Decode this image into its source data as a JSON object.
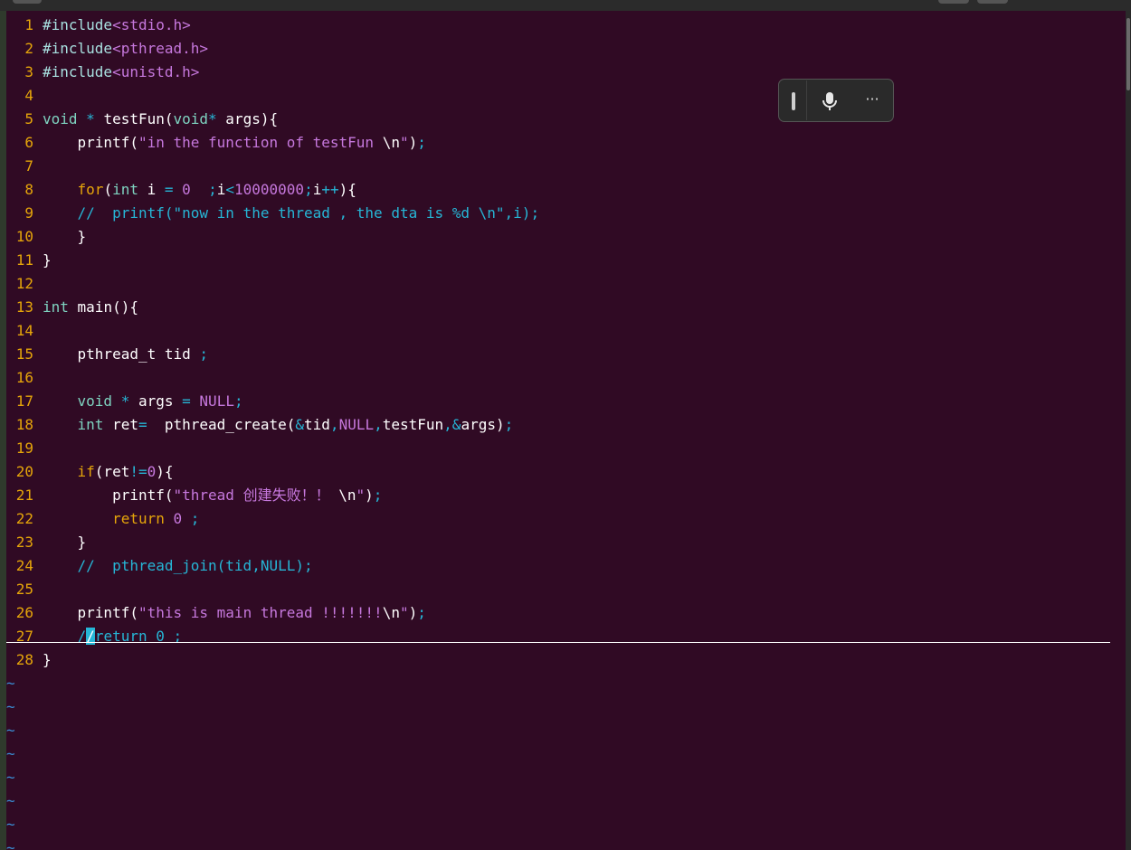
{
  "window": {
    "accent": "#300a24"
  },
  "floatbar": {
    "icons": [
      "drag-handle-icon",
      "microphone-icon",
      "more-options-icon"
    ],
    "more_label": "···"
  },
  "editor": {
    "line_number_color": "#e5a50a",
    "empty_line_marker": "~",
    "cursor_line": 27,
    "lines": [
      {
        "n": "1",
        "tokens": [
          [
            "pp",
            "#include"
          ],
          [
            "str",
            "<stdio.h>"
          ]
        ]
      },
      {
        "n": "2",
        "tokens": [
          [
            "pp",
            "#include"
          ],
          [
            "str",
            "<pthread.h>"
          ]
        ]
      },
      {
        "n": "3",
        "tokens": [
          [
            "pp",
            "#include"
          ],
          [
            "str",
            "<unistd.h>"
          ]
        ]
      },
      {
        "n": "4",
        "tokens": []
      },
      {
        "n": "5",
        "tokens": [
          [
            "kw",
            "void"
          ],
          [
            "op",
            " * "
          ],
          [
            "plain",
            "testFun("
          ],
          [
            "kw",
            "void"
          ],
          [
            "op",
            "*"
          ],
          [
            "plain",
            " args){"
          ]
        ]
      },
      {
        "n": "6",
        "tokens": [
          [
            "plain",
            "    printf("
          ],
          [
            "str",
            "\"in the function of testFun "
          ],
          [
            "plain",
            "\\n"
          ],
          [
            "str",
            "\""
          ],
          [
            "plain",
            ")"
          ],
          [
            "op",
            ";"
          ]
        ]
      },
      {
        "n": "7",
        "tokens": []
      },
      {
        "n": "8",
        "tokens": [
          [
            "plain",
            "    "
          ],
          [
            "ctrl",
            "for"
          ],
          [
            "plain",
            "("
          ],
          [
            "kw",
            "int"
          ],
          [
            "plain",
            " i "
          ],
          [
            "op",
            "="
          ],
          [
            "plain",
            " "
          ],
          [
            "num",
            "0"
          ],
          [
            "plain",
            "  "
          ],
          [
            "op",
            ";"
          ],
          [
            "plain",
            "i"
          ],
          [
            "op",
            "<"
          ],
          [
            "num",
            "10000000"
          ],
          [
            "op",
            ";"
          ],
          [
            "plain",
            "i"
          ],
          [
            "op",
            "++"
          ],
          [
            "plain",
            "){"
          ]
        ]
      },
      {
        "n": "9",
        "tokens": [
          [
            "com",
            "    //  printf(\"now in the thread , the dta is %d \\n\",i);"
          ]
        ]
      },
      {
        "n": "10",
        "tokens": [
          [
            "plain",
            "    }"
          ]
        ]
      },
      {
        "n": "11",
        "tokens": [
          [
            "plain",
            "}"
          ]
        ]
      },
      {
        "n": "12",
        "tokens": []
      },
      {
        "n": "13",
        "tokens": [
          [
            "kw",
            "int"
          ],
          [
            "plain",
            " main(){"
          ]
        ]
      },
      {
        "n": "14",
        "tokens": []
      },
      {
        "n": "15",
        "tokens": [
          [
            "plain",
            "    pthread_t tid "
          ],
          [
            "op",
            ";"
          ]
        ]
      },
      {
        "n": "16",
        "tokens": []
      },
      {
        "n": "17",
        "tokens": [
          [
            "plain",
            "    "
          ],
          [
            "kw",
            "void"
          ],
          [
            "op",
            " * "
          ],
          [
            "plain",
            "args "
          ],
          [
            "op",
            "="
          ],
          [
            "plain",
            " "
          ],
          [
            "num",
            "NULL"
          ],
          [
            "op",
            ";"
          ]
        ]
      },
      {
        "n": "18",
        "tokens": [
          [
            "plain",
            "    "
          ],
          [
            "kw",
            "int"
          ],
          [
            "plain",
            " ret"
          ],
          [
            "op",
            "="
          ],
          [
            "plain",
            "  pthread_create("
          ],
          [
            "op",
            "&"
          ],
          [
            "plain",
            "tid"
          ],
          [
            "op",
            ","
          ],
          [
            "num",
            "NULL"
          ],
          [
            "op",
            ","
          ],
          [
            "plain",
            "testFun"
          ],
          [
            "op",
            ",&"
          ],
          [
            "plain",
            "args)"
          ],
          [
            "op",
            ";"
          ]
        ]
      },
      {
        "n": "19",
        "tokens": []
      },
      {
        "n": "20",
        "tokens": [
          [
            "plain",
            "    "
          ],
          [
            "ctrl",
            "if"
          ],
          [
            "plain",
            "(ret"
          ],
          [
            "op",
            "!="
          ],
          [
            "num",
            "0"
          ],
          [
            "plain",
            "){"
          ]
        ]
      },
      {
        "n": "21",
        "tokens": [
          [
            "plain",
            "        printf("
          ],
          [
            "str",
            "\"thread 创建失败！！ "
          ],
          [
            "plain",
            "\\n"
          ],
          [
            "str",
            "\""
          ],
          [
            "plain",
            ")"
          ],
          [
            "op",
            ";"
          ]
        ]
      },
      {
        "n": "22",
        "tokens": [
          [
            "plain",
            "        "
          ],
          [
            "ctrl",
            "return"
          ],
          [
            "plain",
            " "
          ],
          [
            "num",
            "0"
          ],
          [
            "plain",
            " "
          ],
          [
            "op",
            ";"
          ]
        ]
      },
      {
        "n": "23",
        "tokens": [
          [
            "plain",
            "    }"
          ]
        ]
      },
      {
        "n": "24",
        "tokens": [
          [
            "com",
            "    //  pthread_join(tid,NULL);"
          ]
        ]
      },
      {
        "n": "25",
        "tokens": []
      },
      {
        "n": "26",
        "tokens": [
          [
            "plain",
            "    printf("
          ],
          [
            "str",
            "\"this is main thread !!!!!!!"
          ],
          [
            "plain",
            "\\n"
          ],
          [
            "str",
            "\""
          ],
          [
            "plain",
            ")"
          ],
          [
            "op",
            ";"
          ]
        ]
      },
      {
        "n": "27",
        "tokens": [
          [
            "com",
            "    "
          ],
          [
            "com",
            "/"
          ],
          [
            "cursor",
            "/"
          ],
          [
            "com",
            "return 0 ;"
          ]
        ]
      },
      {
        "n": "28",
        "tokens": [
          [
            "plain",
            "}"
          ]
        ]
      }
    ],
    "tilde_count": 8
  }
}
